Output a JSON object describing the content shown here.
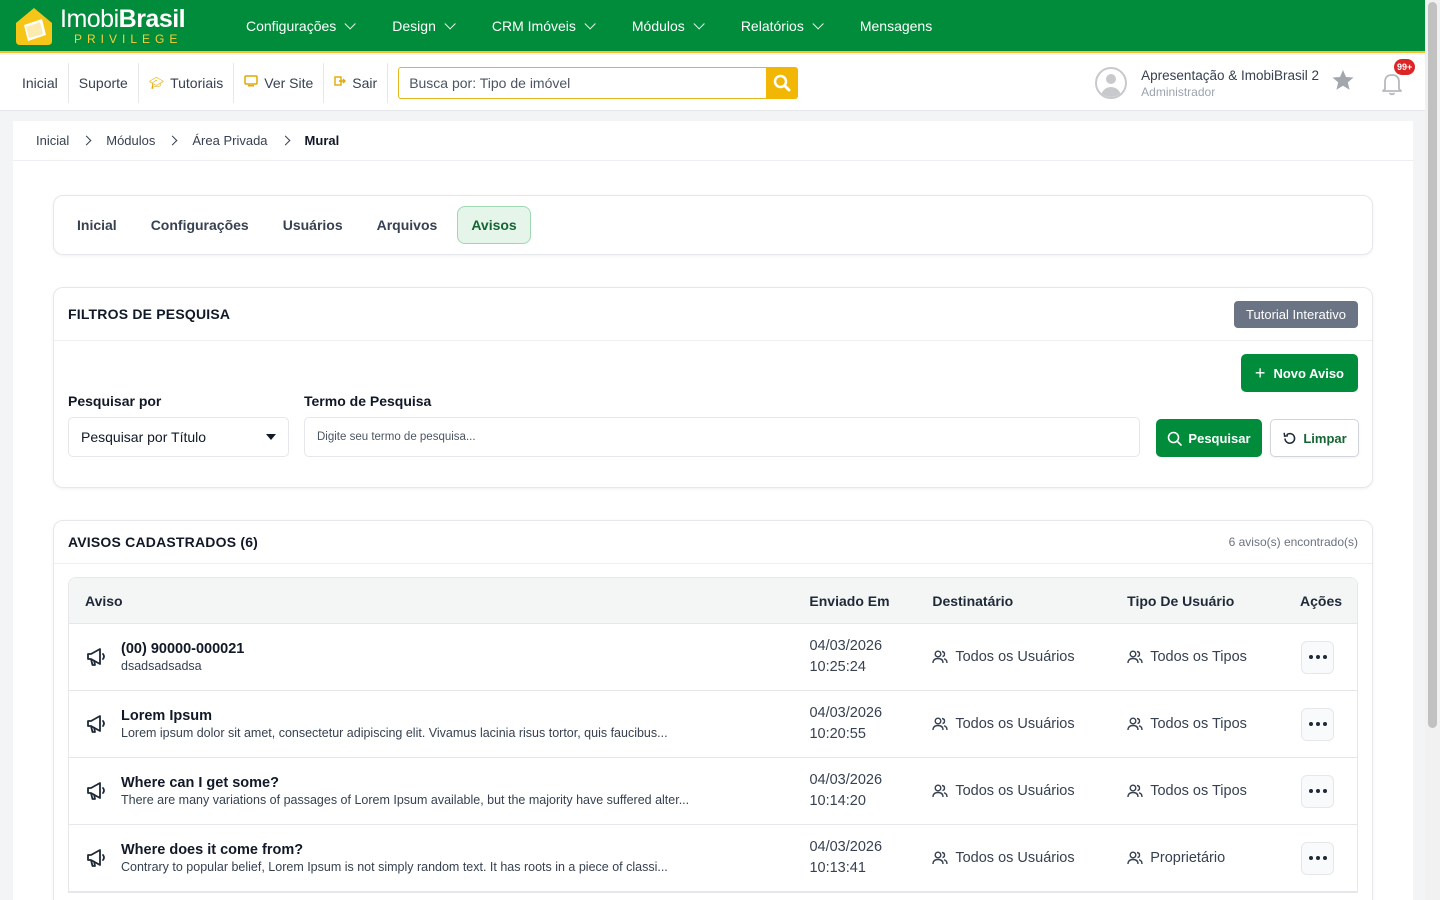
{
  "brand": {
    "name_light": "Imobi",
    "name_bold": "Brasil",
    "tagline": "PRIVILEGE"
  },
  "topnav": [
    {
      "label": "Configurações",
      "dropdown": true
    },
    {
      "label": "Design",
      "dropdown": true
    },
    {
      "label": "CRM Imóveis",
      "dropdown": true
    },
    {
      "label": "Módulos",
      "dropdown": true
    },
    {
      "label": "Relatórios",
      "dropdown": true
    },
    {
      "label": "Mensagens",
      "dropdown": false
    }
  ],
  "subnav": {
    "links": [
      "Inicial",
      "Suporte",
      "Tutoriais",
      "Ver Site",
      "Sair"
    ],
    "search_placeholder": "Busca por: Tipo de imóvel"
  },
  "user": {
    "name": "Apresentação & ImobiBrasil 2",
    "role": "Administrador",
    "notifications": "99+"
  },
  "breadcrumb": [
    "Inicial",
    "Módulos",
    "Área Privada",
    "Mural"
  ],
  "tabs": [
    {
      "label": "Inicial",
      "active": false
    },
    {
      "label": "Configurações",
      "active": false
    },
    {
      "label": "Usuários",
      "active": false
    },
    {
      "label": "Arquivos",
      "active": false
    },
    {
      "label": "Avisos",
      "active": true
    }
  ],
  "filters": {
    "title": "FILTROS DE PESQUISA",
    "tutorial_label": "Tutorial Interativo",
    "new_label": "Novo Aviso",
    "search_by_label": "Pesquisar por",
    "search_by_value": "Pesquisar por Título",
    "term_label": "Termo de Pesquisa",
    "term_placeholder": "Digite seu termo de pesquisa...",
    "search_button": "Pesquisar",
    "clear_button": "Limpar"
  },
  "list": {
    "title": "AVISOS CADASTRADOS (6)",
    "count": "6 aviso(s) encontrado(s)",
    "columns": [
      "Aviso",
      "Enviado Em",
      "Destinatário",
      "Tipo De Usuário",
      "Ações"
    ],
    "rows": [
      {
        "title": "(00) 90000-000021",
        "desc": "dsadsadsadsa",
        "date": "04/03/2026",
        "time": "10:25:24",
        "recipient": "Todos os Usuários",
        "user_type": "Todos os Tipos"
      },
      {
        "title": "Lorem Ipsum",
        "desc": "Lorem ipsum dolor sit amet, consectetur adipiscing elit. Vivamus lacinia risus tortor, quis faucibus...",
        "date": "04/03/2026",
        "time": "10:20:55",
        "recipient": "Todos os Usuários",
        "user_type": "Todos os Tipos"
      },
      {
        "title": "Where can I get some?",
        "desc": "There are many variations of passages of Lorem Ipsum available, but the majority have suffered alter...",
        "date": "04/03/2026",
        "time": "10:14:20",
        "recipient": "Todos os Usuários",
        "user_type": "Todos os Tipos"
      },
      {
        "title": "Where does it come from?",
        "desc": "Contrary to popular belief, Lorem Ipsum is not simply random text. It has roots in a piece of classi...",
        "date": "04/03/2026",
        "time": "10:13:41",
        "recipient": "Todos os Usuários",
        "user_type": "Proprietário"
      }
    ]
  },
  "colors": {
    "primary": "#008c3a",
    "accent": "#f2b705",
    "tab_active_bg": "#e6f5ea",
    "badge": "#dc2626"
  }
}
